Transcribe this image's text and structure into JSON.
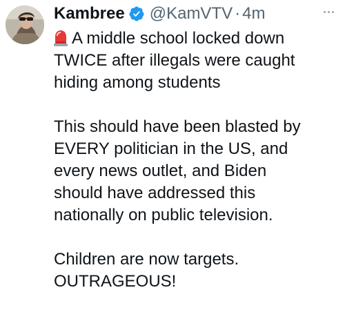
{
  "author": {
    "name": "Kambree",
    "handle": "@KamVTV",
    "separator": "·",
    "time": "4m"
  },
  "icons": {
    "avatar": "avatar-photo",
    "verified": "verified-badge-icon",
    "more": "more-options-icon",
    "siren": "police-siren-emoji"
  },
  "colors": {
    "verified": "#1d9bf0",
    "secondary_text": "#536471",
    "primary_text": "#0f1419"
  },
  "tweet": {
    "line1": "A middle school locked down\nTWICE after illegals were caught\nhiding among students",
    "paragraph2": "This should have been blasted by\nEVERY politician in the US, and\nevery news outlet, and Biden\nshould have addressed this\nnationally on public television.",
    "paragraph3": "Children are now targets.\nOUTRAGEOUS!"
  }
}
